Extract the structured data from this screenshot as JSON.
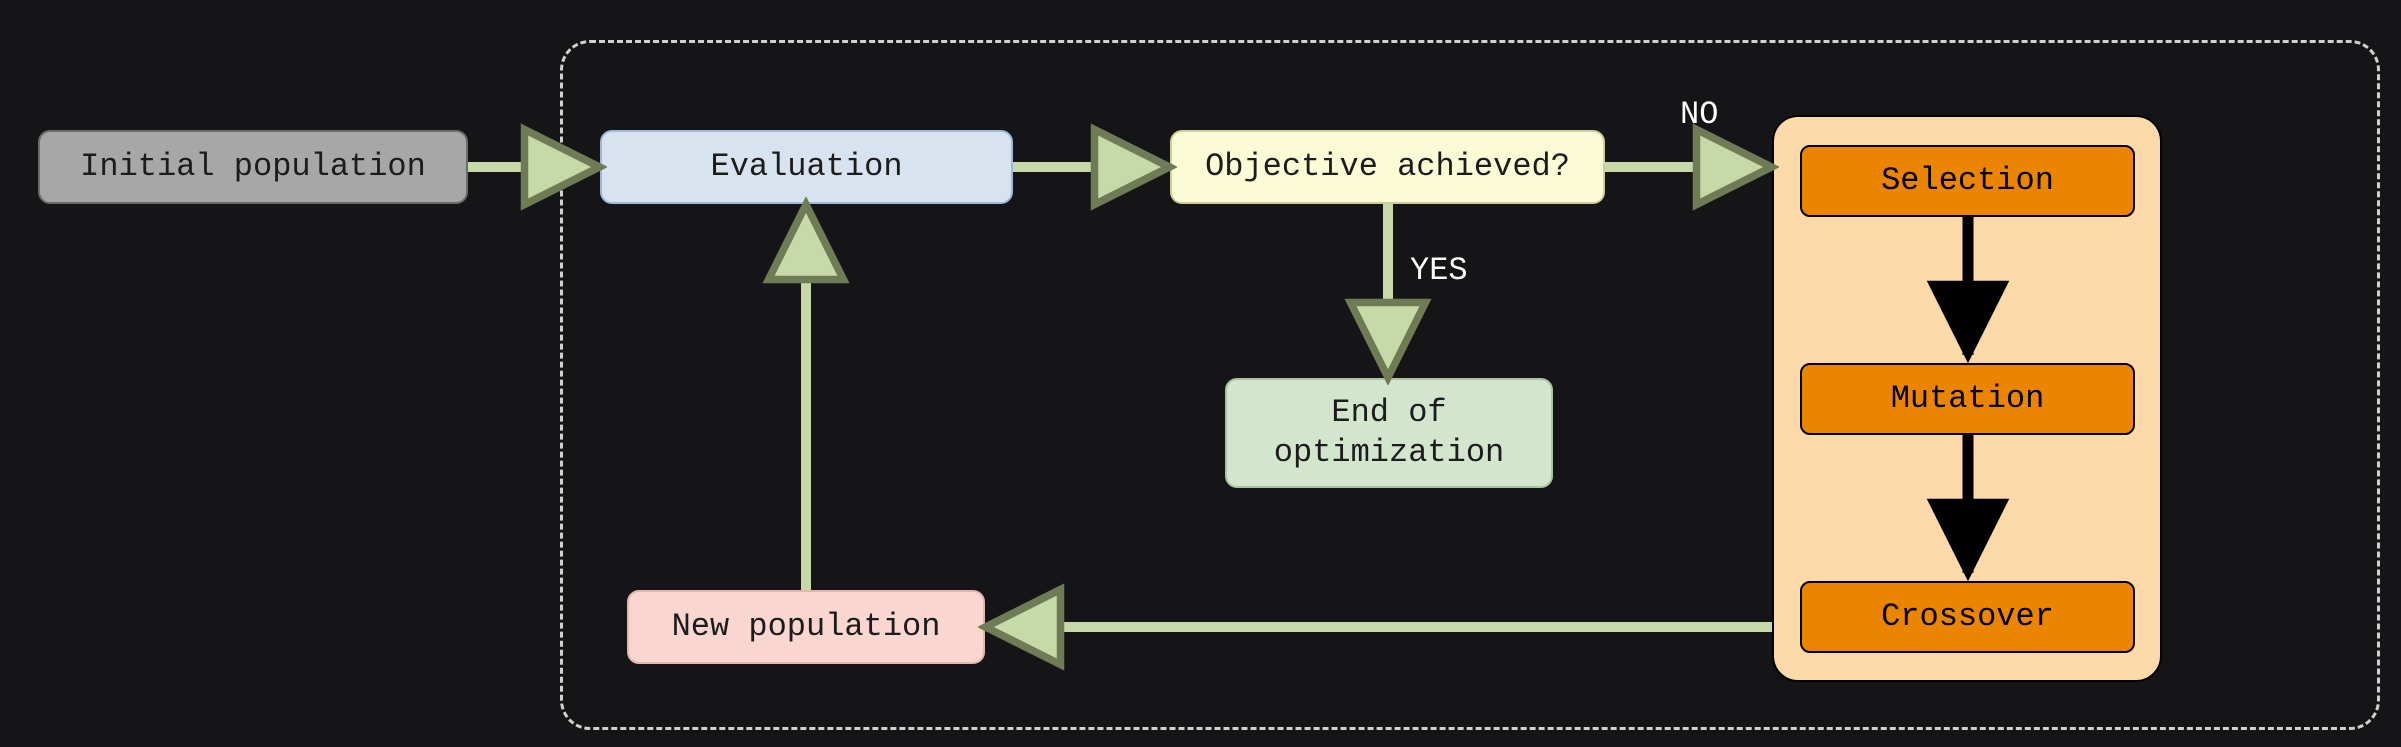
{
  "nodes": {
    "initial": "Initial population",
    "evaluation": "Evaluation",
    "objective": "Objective achieved?",
    "end": "End of\noptimization",
    "newpop": "New population",
    "selection": "Selection",
    "mutation": "Mutation",
    "crossover": "Crossover"
  },
  "labels": {
    "no": "NO",
    "yes": "YES"
  }
}
